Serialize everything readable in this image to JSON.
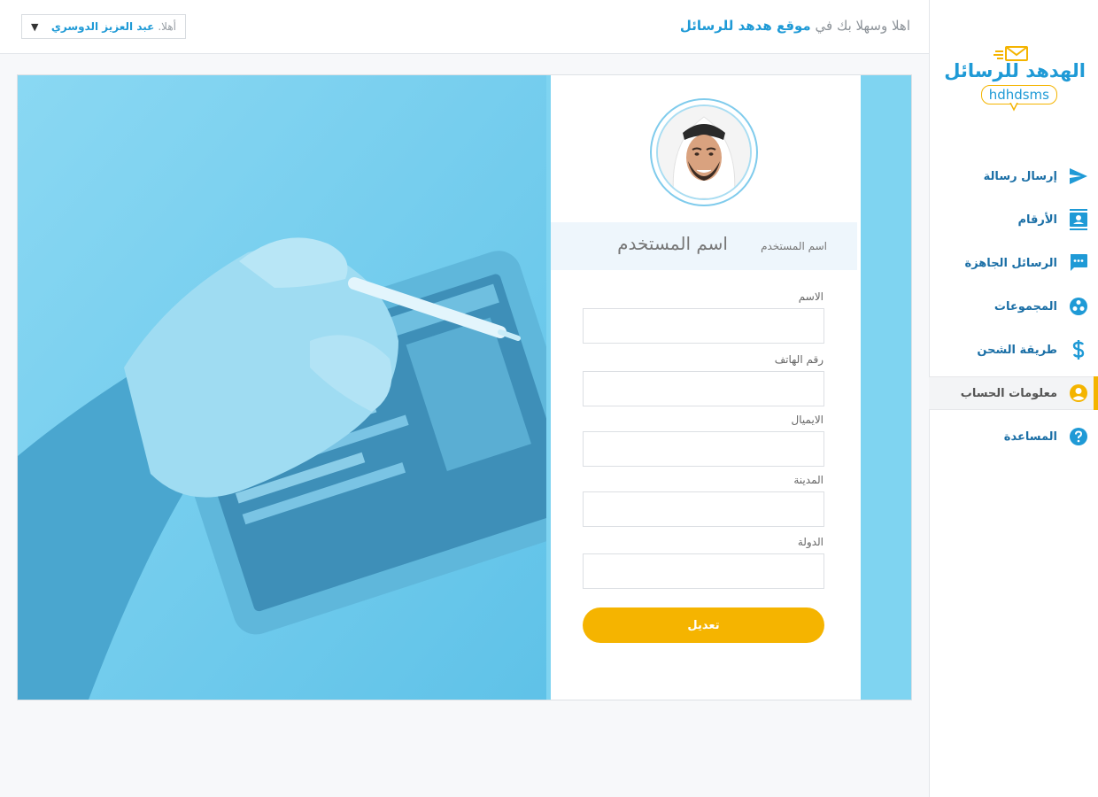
{
  "app": {
    "logo_title": "الهدهد للرسائل",
    "logo_sub": "hdhdsms"
  },
  "topbar": {
    "welcome_prefix": "اهلا وسهلا بك في",
    "welcome_site": "موقع هدهد للرسائل",
    "greet": "أهلا",
    "username": "عبد العزيز الدوسري"
  },
  "nav": [
    {
      "label": "إرسال رسالة",
      "icon": "send-icon",
      "active": false
    },
    {
      "label": "الأرقام",
      "icon": "contacts-icon",
      "active": false
    },
    {
      "label": "الرسائل الجاهزة",
      "icon": "chat-icon",
      "active": false
    },
    {
      "label": "المجموعات",
      "icon": "groups-icon",
      "active": false
    },
    {
      "label": "طريقة الشحن",
      "icon": "dollar-icon",
      "active": false
    },
    {
      "label": "معلومات الحساب",
      "icon": "account-icon",
      "active": true
    },
    {
      "label": "المساعدة",
      "icon": "help-icon",
      "active": false
    }
  ],
  "profile": {
    "username_caption": "اسم المستخدم",
    "username_value": "اسم المستخدم"
  },
  "form": {
    "fields": [
      {
        "label": "الاسم",
        "value": ""
      },
      {
        "label": "رقم الهاتف",
        "value": ""
      },
      {
        "label": "الايميال",
        "value": ""
      },
      {
        "label": "المدينة",
        "value": ""
      },
      {
        "label": "الدولة",
        "value": ""
      }
    ],
    "submit_label": "تعديل"
  },
  "colors": {
    "accent": "#1f9ad6",
    "highlight": "#f4b400",
    "hero_tint": "#7fd4f1"
  }
}
